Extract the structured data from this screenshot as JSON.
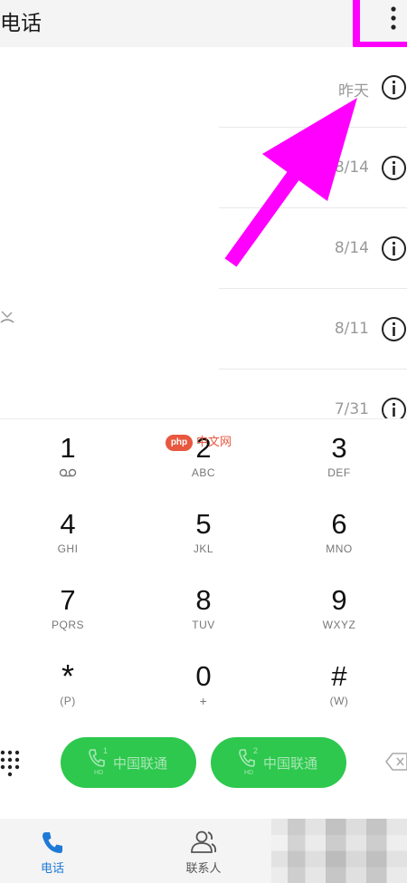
{
  "header": {
    "title": "电话"
  },
  "call_log": [
    {
      "date": "昨天"
    },
    {
      "date": "8/14"
    },
    {
      "date": "8/14"
    },
    {
      "date": "8/11"
    },
    {
      "date": "7/31"
    }
  ],
  "dialpad": [
    {
      "digit": "1",
      "letters": ""
    },
    {
      "digit": "2",
      "letters": "ABC"
    },
    {
      "digit": "3",
      "letters": "DEF"
    },
    {
      "digit": "4",
      "letters": "GHI"
    },
    {
      "digit": "5",
      "letters": "JKL"
    },
    {
      "digit": "6",
      "letters": "MNO"
    },
    {
      "digit": "7",
      "letters": "PQRS"
    },
    {
      "digit": "8",
      "letters": "TUV"
    },
    {
      "digit": "9",
      "letters": "WXYZ"
    },
    {
      "digit": "*",
      "letters": "(P)"
    },
    {
      "digit": "0",
      "letters": "+"
    },
    {
      "digit": "#",
      "letters": "(W)"
    }
  ],
  "call_buttons": [
    {
      "sim": "1",
      "hd": "HD",
      "label": "中国联通"
    },
    {
      "sim": "2",
      "hd": "HD",
      "label": "中国联通"
    }
  ],
  "nav": {
    "phone_label": "电话",
    "contacts_label": "联系人"
  },
  "watermark": {
    "logo": "php",
    "text": "中文网"
  },
  "colors": {
    "accent": "#1e7ad6",
    "call_green": "#2dc84d",
    "annotation": "#ff00ff"
  }
}
